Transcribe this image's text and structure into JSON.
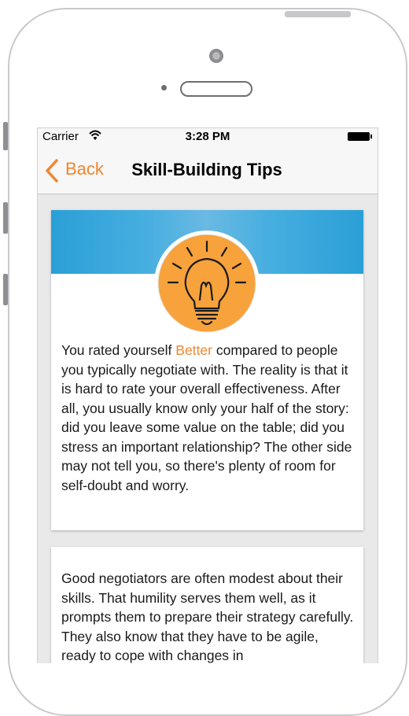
{
  "status_bar": {
    "carrier": "Carrier",
    "time": "3:28 PM"
  },
  "nav": {
    "back_label": "Back",
    "title": "Skill-Building Tips"
  },
  "tips": [
    {
      "text_before": "You rated yourself ",
      "highlight": "Better",
      "text_after": " compared to people you typically negotiate with. The reality is that it is hard to rate your overall effectiveness. After all, you usually know only your half of the story: did you leave some value on the table; did you stress an important relationship? The other side may not tell you, so there's plenty of room for self-doubt and worry."
    },
    {
      "text": "Good negotiators are often modest about their skills. That humility serves them well, as it prompts them to prepare their strategy carefully. They also know that they have to be agile, ready to cope with changes in"
    }
  ],
  "colors": {
    "accent": "#f0862f",
    "banner": "#2a9fd6",
    "bulb": "#f7a23b"
  },
  "icons": [
    "wifi-icon",
    "battery-icon",
    "chevron-left-icon",
    "lightbulb-icon"
  ]
}
